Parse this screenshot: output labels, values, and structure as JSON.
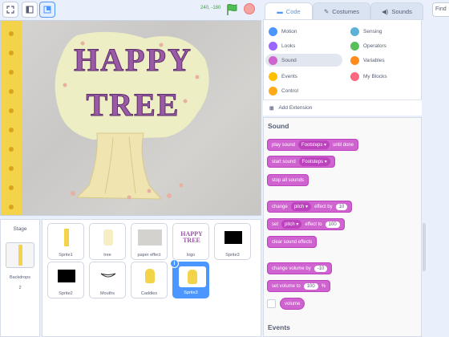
{
  "toolbar": {
    "coords": "240, -180"
  },
  "stage_title": [
    "HAPPY",
    "TREE"
  ],
  "stage_panel": {
    "label": "Stage",
    "backdrops_label": "Backdrops",
    "backdrops_count": "2"
  },
  "sprites": [
    {
      "name": "Sprite1"
    },
    {
      "name": "tree"
    },
    {
      "name": "paper effect"
    },
    {
      "name": "logo"
    },
    {
      "name": "Sprite3"
    },
    {
      "name": "Sprite2"
    },
    {
      "name": "Mouths"
    },
    {
      "name": "Caddies"
    },
    {
      "name": "Sprite3"
    }
  ],
  "tabs": [
    {
      "label": "Code"
    },
    {
      "label": "Costumes"
    },
    {
      "label": "Sounds"
    }
  ],
  "find_label": "Find",
  "categories": [
    {
      "label": "Motion",
      "color": "#4c97ff"
    },
    {
      "label": "Looks",
      "color": "#9966ff"
    },
    {
      "label": "Sound",
      "color": "#cf63cf"
    },
    {
      "label": "Events",
      "color": "#ffbf00"
    },
    {
      "label": "Control",
      "color": "#ffab19"
    },
    {
      "label": "Sensing",
      "color": "#5cb1d6"
    },
    {
      "label": "Operators",
      "color": "#59c059"
    },
    {
      "label": "Variables",
      "color": "#ff8c1a"
    },
    {
      "label": "My Blocks",
      "color": "#ff6680"
    }
  ],
  "add_extension": "Add Extension",
  "sound_header": "Sound",
  "blocks": {
    "play_sound": {
      "text": "play sound",
      "menu": "Footsteps",
      "suffix": "until done"
    },
    "start_sound": {
      "text": "start sound",
      "menu": "Footsteps"
    },
    "stop_all": "stop all sounds",
    "change_effect": {
      "text": "change",
      "menu": "pitch",
      "mid": "effect by",
      "value": "10"
    },
    "set_effect": {
      "text": "set",
      "menu": "pitch",
      "mid": "effect to",
      "value": "100"
    },
    "clear_effects": "clear sound effects",
    "change_volume": {
      "text": "change volume by",
      "value": "-10"
    },
    "set_volume": {
      "text": "set volume to",
      "value": "100",
      "suffix": "%"
    },
    "volume": "volume"
  },
  "events_header": "Events"
}
